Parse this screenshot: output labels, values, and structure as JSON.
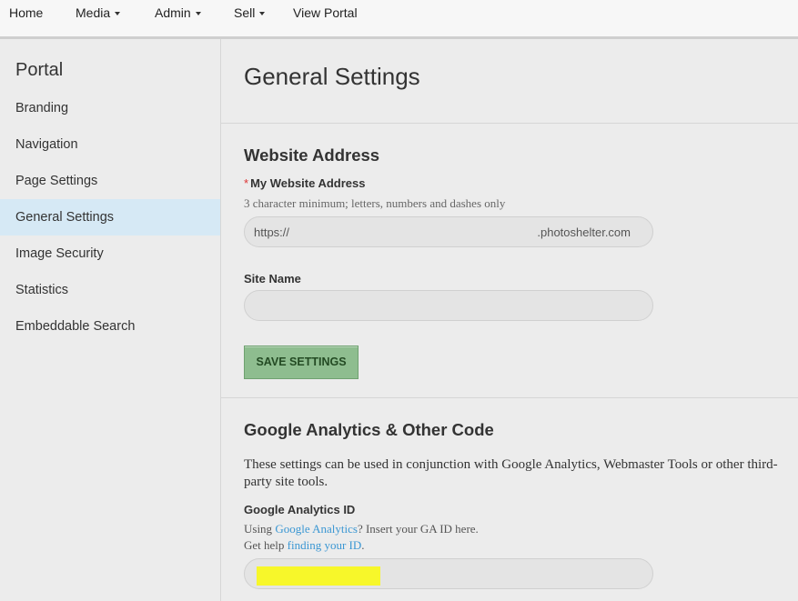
{
  "nav": {
    "items": [
      {
        "label": "Home",
        "dropdown": false
      },
      {
        "label": "Media",
        "dropdown": true
      },
      {
        "label": "Admin",
        "dropdown": true
      },
      {
        "label": "Sell",
        "dropdown": true
      },
      {
        "label": "View Portal",
        "dropdown": false
      }
    ]
  },
  "sidebar": {
    "heading": "Portal",
    "items": [
      {
        "label": "Branding",
        "active": false
      },
      {
        "label": "Navigation",
        "active": false
      },
      {
        "label": "Page Settings",
        "active": false
      },
      {
        "label": "General Settings",
        "active": true
      },
      {
        "label": "Image Security",
        "active": false
      },
      {
        "label": "Statistics",
        "active": false
      },
      {
        "label": "Embeddable Search",
        "active": false
      }
    ]
  },
  "main": {
    "title": "General Settings",
    "website_section": {
      "title": "Website Address",
      "address_label": "My Website Address",
      "required_marker": "*",
      "address_hint": "3 character minimum; letters, numbers and dashes only",
      "address_prefix": "https://",
      "address_value": "",
      "address_suffix": ".photoshelter.com",
      "site_name_label": "Site Name",
      "site_name_value": "",
      "save_label": "SAVE SETTINGS"
    },
    "analytics_section": {
      "title": "Google Analytics & Other Code",
      "description": "These settings can be used in conjunction with Google Analytics, Webmaster Tools or other third-party site tools.",
      "ga_label": "Google Analytics ID",
      "hint_line1_prefix": "Using ",
      "hint_line1_link": "Google Analytics",
      "hint_line1_suffix": "? Insert your GA ID here.",
      "hint_line2_prefix": "Get help ",
      "hint_line2_link": "finding your ID",
      "hint_line2_suffix": ".",
      "ga_value": ""
    }
  },
  "colors": {
    "active_sidebar_bg": "#d6e9f5",
    "save_button_bg": "#8ebd8f",
    "link": "#3b97d3",
    "required": "#dd3333",
    "redaction_highlight": "#f7f72a"
  }
}
